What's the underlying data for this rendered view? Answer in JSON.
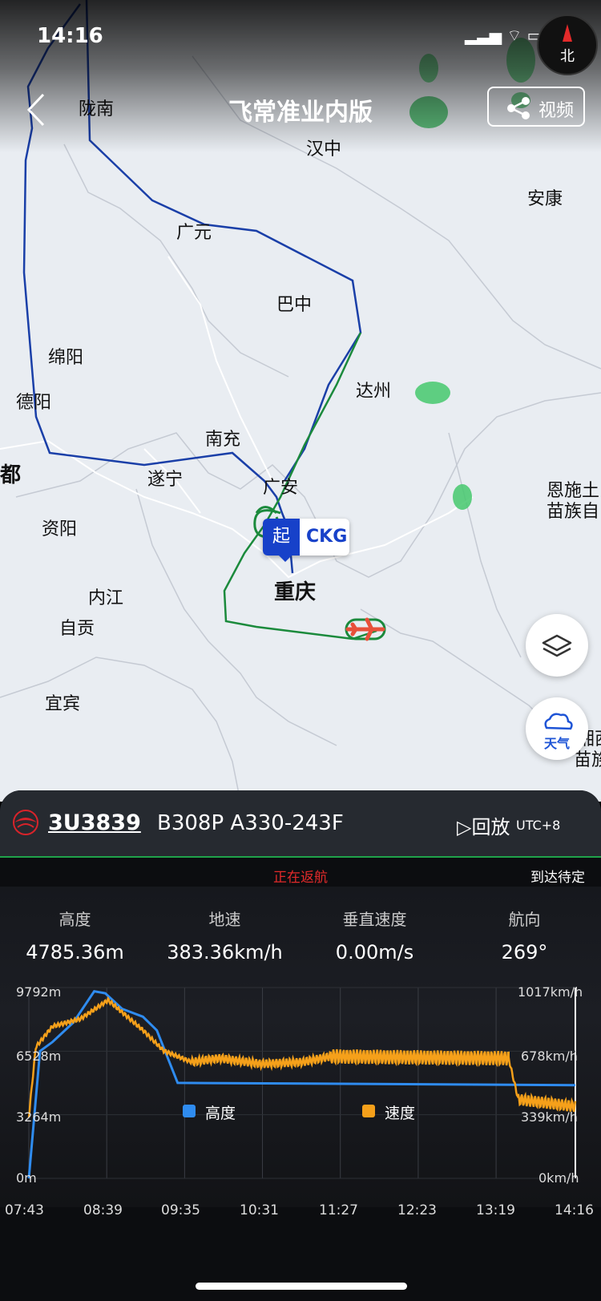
{
  "status_bar": {
    "time": "14:16",
    "icons": "▂▃▅ ⌔ ▭"
  },
  "compass": {
    "label": "北"
  },
  "header": {
    "title": "飞常准业内版",
    "video_label": "视频"
  },
  "map": {
    "cities": {
      "longnan": "陇南",
      "hanzhong": "汉中",
      "ankang": "安康",
      "guangyuan": "广元",
      "bazhong": "巴中",
      "mianyang": "绵阳",
      "deyang": "德阳",
      "dazhou": "达州",
      "nanchong": "南充",
      "suining": "遂宁",
      "guangan": "广安",
      "chengdu": "都",
      "ziyang": "资阳",
      "enshi1": "恩施土",
      "enshi2": "苗族自",
      "neijiang": "内江",
      "chongqing": "重庆",
      "zigong": "自贡",
      "yibin": "宜宾",
      "xiangxi1": "湘西",
      "xiangxi2": "苗族"
    },
    "departure_marker": {
      "badge": "起",
      "code": "CKG"
    },
    "weather_button": "天气",
    "route_colors": {
      "first_leg": "#1a3fa8",
      "return_leg": "#1b8a3c"
    }
  },
  "flight": {
    "number": "3U3839",
    "aircraft": "B308P A330-243F",
    "playback": "▷回放",
    "utc": "UTC+8",
    "status": "正在返航",
    "arrival": "到达待定"
  },
  "metrics": [
    {
      "label": "高度",
      "value": "4785.36m"
    },
    {
      "label": "地速",
      "value": "383.36km/h"
    },
    {
      "label": "垂直速度",
      "value": "0.00m/s"
    },
    {
      "label": "航向",
      "value": "269°"
    }
  ],
  "chart_data": {
    "type": "line",
    "x_ticks": [
      "07:43",
      "08:39",
      "09:35",
      "10:31",
      "11:27",
      "12:23",
      "13:19",
      "14:16"
    ],
    "y_left_ticks": [
      "9792m",
      "6528m",
      "3264m",
      "0m"
    ],
    "y_right_ticks": [
      "1017km/h",
      "678km/h",
      "339km/h",
      "0km/h"
    ],
    "ylim_left": [
      0,
      9792
    ],
    "ylim_right": [
      0,
      1017
    ],
    "legend_position": "center",
    "series": [
      {
        "name": "高度",
        "color": "#2f8cf0",
        "axis": "left",
        "points": [
          [
            "07:43",
            0
          ],
          [
            "07:51",
            6530
          ],
          [
            "08:00",
            7000
          ],
          [
            "08:15",
            8000
          ],
          [
            "08:30",
            9600
          ],
          [
            "08:38",
            9500
          ],
          [
            "08:50",
            8700
          ],
          [
            "09:05",
            8300
          ],
          [
            "09:15",
            7600
          ],
          [
            "09:30",
            4900
          ],
          [
            "14:16",
            4785
          ]
        ]
      },
      {
        "name": "速度",
        "color": "#f5a01a",
        "axis": "right",
        "note_oscillation": true,
        "points": [
          [
            "07:43",
            330
          ],
          [
            "07:48",
            700
          ],
          [
            "08:00",
            810
          ],
          [
            "08:20",
            850
          ],
          [
            "08:40",
            950
          ],
          [
            "09:05",
            790
          ],
          [
            "09:20",
            680
          ],
          [
            "09:40",
            620
          ],
          [
            "10:00",
            640
          ],
          [
            "10:30",
            610
          ],
          [
            "11:00",
            620
          ],
          [
            "11:20",
            650
          ],
          [
            "13:28",
            640
          ],
          [
            "13:35",
            420
          ],
          [
            "14:16",
            383
          ]
        ]
      }
    ]
  }
}
